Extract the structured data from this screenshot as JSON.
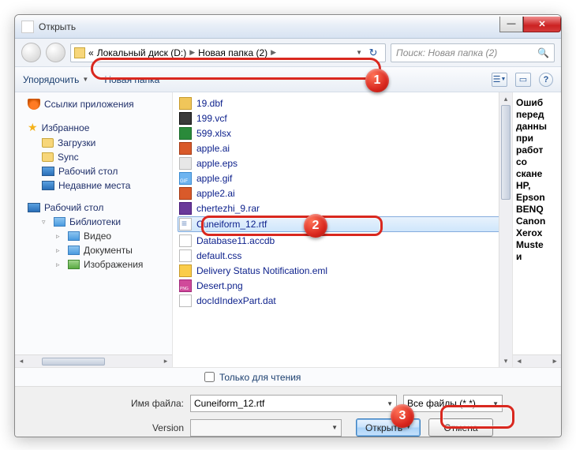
{
  "window": {
    "title": "Открыть"
  },
  "breadcrumb": {
    "part1": "Локальный диск (D:)",
    "part2": "Новая папка (2)",
    "chev": "«"
  },
  "search": {
    "placeholder": "Поиск: Новая папка (2)"
  },
  "toolbar": {
    "organize": "Упорядочить",
    "newfolder": "Новая папка"
  },
  "sidebar": {
    "appLinks": "Ссылки приложения",
    "favorites": "Избранное",
    "downloads": "Загрузки",
    "sync": "Sync",
    "desktop": "Рабочий стол",
    "recent": "Недавние места",
    "desktop2": "Рабочий стол",
    "libraries": "Библиотеки",
    "videos": "Видео",
    "documents": "Документы",
    "pictures": "Изображения"
  },
  "files": [
    {
      "n": "19.dbf",
      "t": "dbf"
    },
    {
      "n": "199.vcf",
      "t": "vcf"
    },
    {
      "n": "599.xlsx",
      "t": "xls"
    },
    {
      "n": "apple.ai",
      "t": "ai"
    },
    {
      "n": "apple.eps",
      "t": "eps"
    },
    {
      "n": "apple.gif",
      "t": "gif"
    },
    {
      "n": "apple2.ai",
      "t": "ai"
    },
    {
      "n": "chertezhi_9.rar",
      "t": "rar"
    },
    {
      "n": "Cuneiform_12.rtf",
      "t": "rtf"
    },
    {
      "n": "Database11.accdb",
      "t": "accdb"
    },
    {
      "n": "default.css",
      "t": "css"
    },
    {
      "n": "Delivery Status Notification.eml",
      "t": "eml"
    },
    {
      "n": "Desert.png",
      "t": "png"
    },
    {
      "n": "docIdIndexPart.dat",
      "t": "dat"
    }
  ],
  "selectedIndex": 8,
  "readonly": "Только для чтения",
  "bottom": {
    "fnameLabel": "Имя файла:",
    "fnameValue": "Cuneiform_12.rtf",
    "ftypeValue": "Все файлы (*.*)",
    "versionLabel": "Version",
    "open": "Открыть",
    "cancel": "Отмена"
  },
  "preview": [
    "Ошиб",
    "перед",
    "данны",
    "при",
    "работ",
    "со",
    "скане",
    "HP,",
    "Epson",
    "BENQ",
    "Canon",
    "Xerox",
    "Muste",
    "и"
  ],
  "badges": [
    "1",
    "2",
    "3"
  ]
}
